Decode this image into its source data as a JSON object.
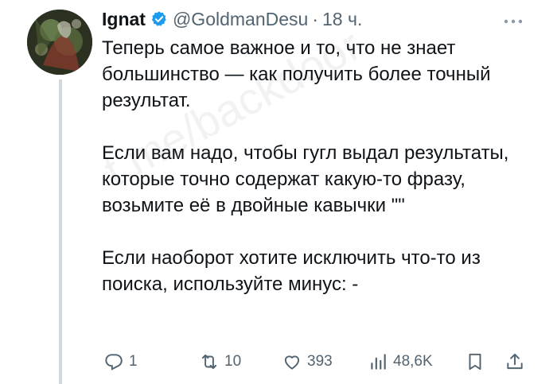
{
  "author": {
    "display_name": "Ignat",
    "handle": "@GoldmanDesu",
    "separator": "·",
    "time": "18 ч."
  },
  "body": {
    "paragraphs": [
      "Теперь самое важное и то, что не знает большинство — как получить более точный результат.",
      "Если вам надо, чтобы гугл выдал результаты, которые точно содержат какую-то фразу, возьмите её в двойные кавычки \"\"",
      "Если наоборот хотите исключить что-то из поиска, используйте минус: -"
    ]
  },
  "watermark": "t.me/backdoor",
  "actions": {
    "replies": "1",
    "retweets": "10",
    "likes": "393",
    "views": "48,6K"
  },
  "icons": [
    "more-icon",
    "verified-icon",
    "reply-icon",
    "retweet-icon",
    "like-icon",
    "views-icon",
    "bookmark-icon",
    "share-icon"
  ],
  "colors": {
    "verified": "#1d9bf0",
    "text": "#0f1419",
    "secondary": "#536471"
  }
}
